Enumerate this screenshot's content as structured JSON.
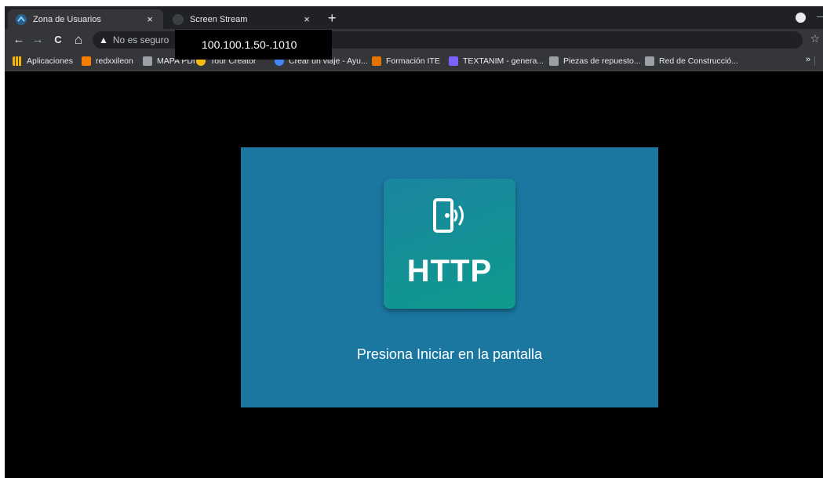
{
  "tabs": [
    {
      "title": "Zona de Usuarios",
      "close": "×",
      "active": true
    },
    {
      "title": "Screen Stream",
      "close": "×",
      "active": false
    }
  ],
  "newtab_label": "+",
  "toolbar": {
    "back": "←",
    "forward": "→",
    "reload": "C",
    "home": "⌂",
    "security_text": "No es seguro",
    "star": "☆"
  },
  "bookmarks": [
    {
      "label": "Aplicaciones",
      "icon": "apps-icon",
      "color": "#f4b400"
    },
    {
      "label": "redxxileon",
      "icon": "blogger-icon",
      "color": "#f57c00"
    },
    {
      "label": "MAPA PDI",
      "icon": "map-icon",
      "color": "#9aa0a6"
    },
    {
      "label": "Tour Creator",
      "icon": "tour-icon",
      "color": "#fbbc04"
    },
    {
      "label": "Crear un viaje - Ayu...",
      "icon": "google-icon",
      "color": "#4285f4"
    },
    {
      "label": "Formación ITE",
      "icon": "chart-icon",
      "color": "#e37400"
    },
    {
      "label": "TEXTANIM - genera...",
      "icon": "textanim-icon",
      "color": "#7b61ff"
    },
    {
      "label": "Piezas de repuesto...",
      "icon": "parts-icon",
      "color": "#9aa0a6"
    },
    {
      "label": "Red de Construcció...",
      "icon": "network-icon",
      "color": "#9aa0a6"
    }
  ],
  "bookmarks_more": "»",
  "tooltip_url": "100.100.1.50-.1010",
  "stream": {
    "logo_text": "HTTP",
    "message": "Presiona Iniciar en la pantalla",
    "background": "#1b76a0"
  }
}
